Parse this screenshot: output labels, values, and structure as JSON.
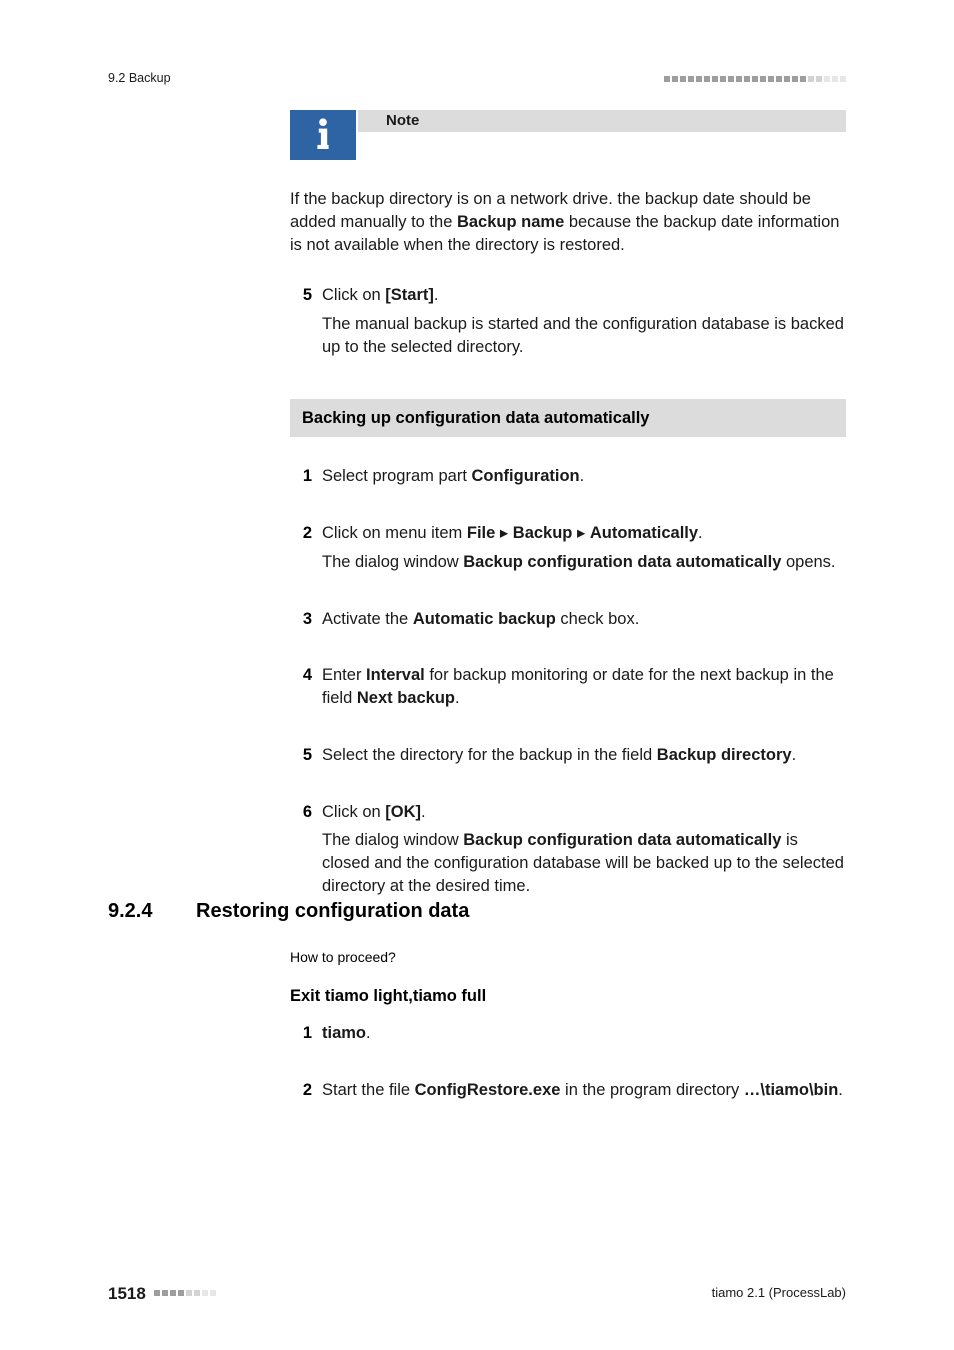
{
  "header": {
    "section": "9.2 Backup"
  },
  "note": {
    "title": "Note",
    "body_pre": "If the backup directory is on a network drive. the backup date should be added manually to the ",
    "body_bold": "Backup name",
    "body_post": " because the backup date information is not available when the directory is restored."
  },
  "step5a": {
    "num": "5",
    "line_pre": "Click on ",
    "line_bold": "[Start]",
    "line_post": ".",
    "sub": "The manual backup is started and the configuration database is backed up to the selected directory."
  },
  "autohead": "Backing up configuration data automatically",
  "auto": {
    "s1": {
      "num": "1",
      "pre": "Select program part ",
      "b": "Configuration",
      "post": "."
    },
    "s2": {
      "num": "2",
      "pre": "Click on menu item ",
      "b1": "File",
      "sep": " ▸ ",
      "b2": "Backup",
      "b3": "Automatically",
      "post": ".",
      "sub_pre": "The dialog window ",
      "sub_b": "Backup configuration data automatically",
      "sub_post": " opens."
    },
    "s3": {
      "num": "3",
      "pre": "Activate the ",
      "b": "Automatic backup",
      "post": " check box."
    },
    "s4": {
      "num": "4",
      "pre": "Enter ",
      "b1": "Interval",
      "mid": " for backup monitoring or date for the next backup in the field ",
      "b2": "Next backup",
      "post": "."
    },
    "s5": {
      "num": "5",
      "pre": "Select the directory for the backup in the field ",
      "b": "Backup directory",
      "post": "."
    },
    "s6": {
      "num": "6",
      "pre": "Click on ",
      "b": "[OK]",
      "post": ".",
      "sub_pre": "The dialog window ",
      "sub_b": "Backup configuration data automatically",
      "sub_post": " is closed and the configuration database will be backed up to the selected directory at the desired time."
    }
  },
  "h924": {
    "num": "9.2.4",
    "title": "Restoring configuration data",
    "howto": "How to proceed?"
  },
  "exitHead": "Exit tiamo light,tiamo full",
  "exit": {
    "s1": {
      "num": "1",
      "b": "tiamo",
      "post": "."
    },
    "s2": {
      "num": "2",
      "pre": "Start the file ",
      "b1": "ConfigRestore.exe",
      "mid": " in the program directory ",
      "b2": "…\\tiamo\\bin",
      "post": "."
    }
  },
  "footer": {
    "page": "1518",
    "right": "tiamo 2.1 (ProcessLab)"
  }
}
